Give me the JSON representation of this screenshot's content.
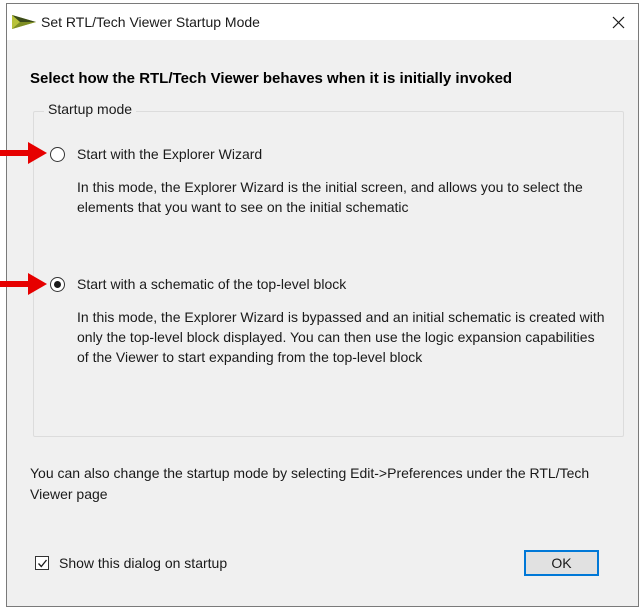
{
  "window": {
    "title": "Set RTL/Tech Viewer Startup Mode"
  },
  "heading": "Select how the RTL/Tech Viewer behaves when it is initially invoked",
  "group": {
    "legend": "Startup mode",
    "options": [
      {
        "label": "Start with the Explorer Wizard",
        "selected": false,
        "description": "In this mode, the Explorer Wizard is the initial screen, and allows you to select the elements that you want to see on the initial schematic"
      },
      {
        "label": "Start with a schematic of the top-level block",
        "selected": true,
        "description": "In this mode, the Explorer Wizard is bypassed and an initial schematic is created with only the top-level block displayed. You can then use the logic expansion capabilities of the Viewer to start expanding from the top-level block"
      }
    ]
  },
  "footer_note": "You can also change the startup mode by selecting Edit->Preferences under the RTL/Tech Viewer page",
  "show_on_startup": {
    "label": "Show this dialog on startup",
    "checked": true
  },
  "ok_label": "OK",
  "colors": {
    "annotation_arrow": "#e60000",
    "app_icon_dark": "#3a4a1a",
    "app_icon_light": "#b8c23a",
    "ok_focus_border": "#0078d7",
    "dialog_background": "#f0f0f0"
  },
  "icons": {
    "app": "app-logo-icon",
    "close": "close-icon",
    "check": "checkmark-icon",
    "arrow": "red-arrow-icon"
  }
}
